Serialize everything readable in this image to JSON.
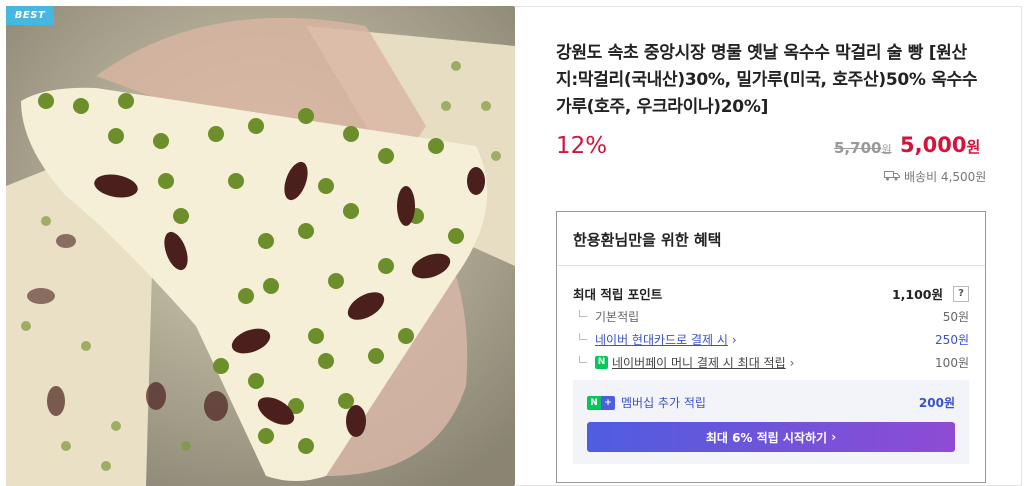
{
  "badge": "BEST",
  "product": {
    "title": "강원도 속초 중앙시장 명물 옛날 옥수수 막걸리 술 빵 [원산지:막걸리(국내산)30%, 밀가루(미국, 호주산)50% 옥수수가루(호주, 우크라이나)20%]",
    "discount": "12%",
    "original_price": "5,700",
    "original_unit": "원",
    "price": "5,000",
    "price_unit": "원",
    "shipping": "배송비 4,500원"
  },
  "benefit": {
    "title": "한용환님만을 위한 혜택",
    "max_label": "최대 적립 포인트",
    "max_value": "1,100원",
    "help": "?",
    "rows": [
      {
        "label": "기본적립",
        "value": "50원"
      },
      {
        "label": "네이버 현대카드로 결제 시",
        "value": "250원"
      },
      {
        "label": "네이버페이 머니 결제 시 최대 적립",
        "value": "100원"
      }
    ],
    "member_label": "멤버십 추가 적립",
    "member_value": "200원",
    "cta": "최대 6% 적립 시작하기"
  },
  "colors": {
    "accent": "#d4143c",
    "link": "#3b52c8",
    "badge": "#46b8e0",
    "naver": "#03c75a"
  },
  "icons": [
    "truck-icon",
    "chevron-right-icon",
    "naver-pay-icon",
    "naver-plus-icon"
  ]
}
